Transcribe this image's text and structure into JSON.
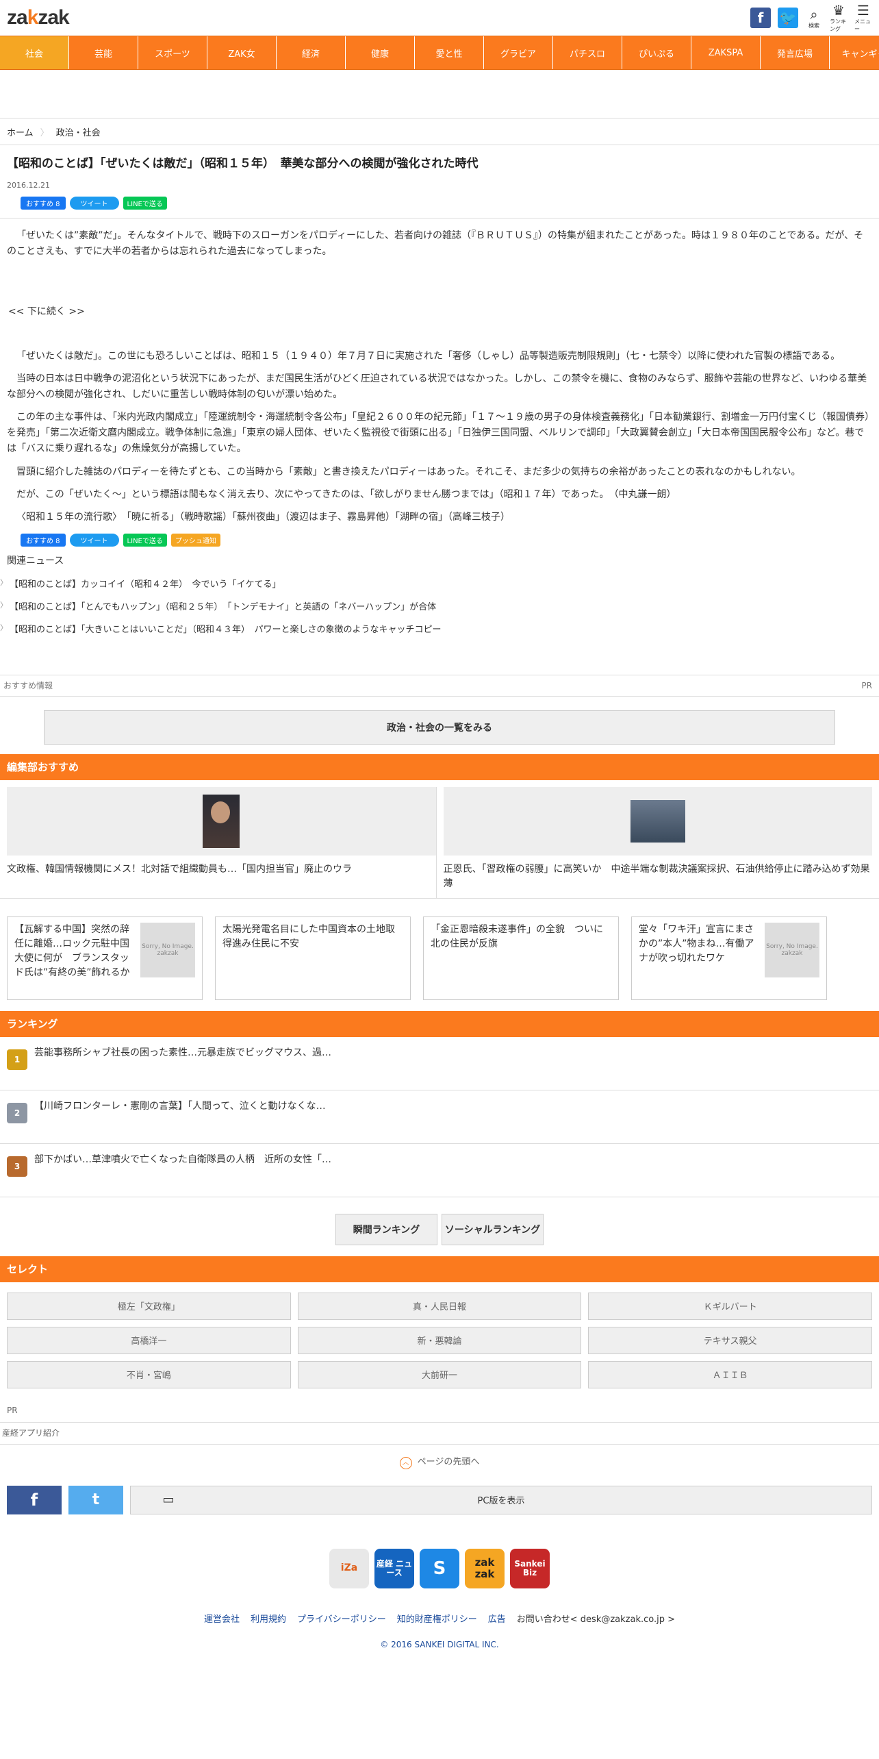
{
  "brand": {
    "logo_a": "za",
    "logo_o": "k",
    "logo_b": "zak"
  },
  "header": {
    "fb": "f",
    "search": "検索",
    "ranking": "ランキング",
    "menu": "メニュー"
  },
  "nav": [
    "社会",
    "芸能",
    "スポーツ",
    "ZAK女",
    "経済",
    "健康",
    "愛と性",
    "グラビア",
    "パチスロ",
    "ぴいぷる",
    "ZAKSPA",
    "発言広場",
    "キャンギャ"
  ],
  "breadcrumb": {
    "home": "ホーム",
    "sep": "〉",
    "section": "政治・社会"
  },
  "article": {
    "title": "【昭和のことば】「ぜいたくは敵だ」（昭和１５年）　華美な部分への検閲が強化された時代",
    "date": "2016.12.21",
    "share": {
      "fb": "おすすめ 8",
      "tw": "ツイート",
      "line": "LINEで送る",
      "push": "プッシュ通知"
    },
    "intro": "「ぜいたくは”素敵”だ」。そんなタイトルで、戦時下のスローガンをパロディーにした、若者向けの雑誌（『ＢＲＵＴＵＳ』）の特集が組まれたことがあった。時は１９８０年のことである。だが、そのことさえも、すでに大半の若者からは忘れられた過去になってしまった。",
    "continue": "<< 下に続く >>",
    "paragraphs": [
      "「ぜいたくは敵だ」。この世にも恐ろしいことばは、昭和１５（１９４０）年７月７日に実施された「奢侈（しゃし）品等製造販売制限規則」（七・七禁令）以降に使われた官製の標語である。",
      "当時の日本は日中戦争の泥沼化という状況下にあったが、まだ国民生活がひどく圧迫されている状況ではなかった。しかし、この禁令を機に、食物のみならず、服飾や芸能の世界など、いわゆる華美な部分への検閲が強化され、しだいに重苦しい戦時体制の匂いが漂い始めた。",
      "この年の主な事件は、「米内光政内閣成立」「陸運統制令・海運統制令各公布」「皇紀２６００年の紀元節」「１７～１９歳の男子の身体検査義務化」「日本勧業銀行、割増金一万円付宝くじ（報国債券）を発売」「第二次近衛文麿内閣成立。戦争体制に急進」「東京の婦人団体、ぜいたく監視役で街頭に出る」「日独伊三国同盟、ベルリンで調印」「大政翼賛会創立」「大日本帝国国民服令公布」など。巷では「バスに乗り遅れるな」の焦燥気分が高揚していた。",
      "冒頭に紹介した雑誌のパロディーを待たずとも、この当時から「素敵」と書き換えたパロディーはあった。それこそ、まだ多少の気持ちの余裕があったことの表れなのかもしれない。",
      "だが、この「ぜいたく～」という標語は間もなく消え去り、次にやってきたのは、「欲しがりません勝つまでは」（昭和１７年）であった。　（中丸謙一朗）",
      "〈昭和１５年の流行歌〉　「暁に祈る」（戦時歌謡）「蘇州夜曲」（渡辺はま子、霧島昇他）「湖畔の宿」（高峰三枝子）"
    ]
  },
  "related": {
    "heading": "関連ニュース",
    "items": [
      "【昭和のことば】カッコイイ（昭和４２年）　今でいう「イケてる」",
      "【昭和のことば】「とんでもハップン」（昭和２５年）　「トンデモナイ」と英語の「ネバーハップン」が合体",
      "【昭和のことば】「大きいことはいいことだ」（昭和４３年）　パワーと楽しさの象徴のようなキャッチコピー"
    ]
  },
  "osusume": {
    "label": "おすすめ情報",
    "pr": "PR"
  },
  "list_button": "政治・社会の一覧をみる",
  "editor": {
    "heading": "編集部おすすめ",
    "picks": [
      "文政権、韓国情報機関にメス！北対話で組織動員も…「国内担当官」廃止のウラ",
      "正恩氏、「習政権の弱腰」に高笑いか　中途半端な制裁決議案採択、石油供給停止に踏み込めず効果薄"
    ],
    "cards": [
      "【瓦解する中国】突然の辞任に離婚…ロック元駐中国大使に何が　ブランスタッド氏は”有終の美”飾れるか",
      "太陽光発電名目にした中国資本の土地取得進み住民に不安",
      "「金正恩暗殺未遂事件」の全貌　ついに北の住民が反旗",
      "堂々「ワキ汗」宣言にまさかの”本人”物まね…有働アナが吹っ切れたワケ"
    ],
    "noimg": "Sorry, No Image. zakzak"
  },
  "ranking": {
    "heading": "ランキング",
    "items": [
      {
        "n": "1",
        "t": "芸能事務所シャブ社長の困った素性…元暴走族でビッグマウス、過…"
      },
      {
        "n": "2",
        "t": "【川崎フロンターレ・憲剛の言葉】「人間って、泣くと動けなくな…"
      },
      {
        "n": "3",
        "t": "部下かばい…草津噴火で亡くなった自衛隊員の人柄　近所の女性「…"
      }
    ],
    "btn_instant": "瞬間ランキング",
    "btn_social": "ソーシャルランキング"
  },
  "select": {
    "heading": "セレクト",
    "items": [
      "極左「文政権」",
      "真・人民日報",
      "Ｋギルバート",
      "高橋洋一",
      "新・悪韓論",
      "テキサス親父",
      "不肖・宮嶋",
      "大前研一",
      "ＡＩＩＢ"
    ]
  },
  "pr": "PR",
  "app": "産経アプリ紹介",
  "pagetop": "ページの先頭へ",
  "footer": {
    "fb": "f",
    "tw": "t",
    "pc": "PC版を表示",
    "logos": [
      "iZa",
      "産経 ニュース",
      "S",
      "zak zak",
      "Sankei Biz"
    ],
    "links": [
      "運営会社",
      "利用規約",
      "プライバシーポリシー",
      "知的財産権ポリシー",
      "広告"
    ],
    "contact": "お問い合わせ< desk@zakzak.co.jp >",
    "copy": "© 2016 SANKEI DIGITAL INC."
  },
  "colors": {
    "accent": "#fb7a1e",
    "fb": "#3b5998",
    "tw": "#55acee"
  }
}
